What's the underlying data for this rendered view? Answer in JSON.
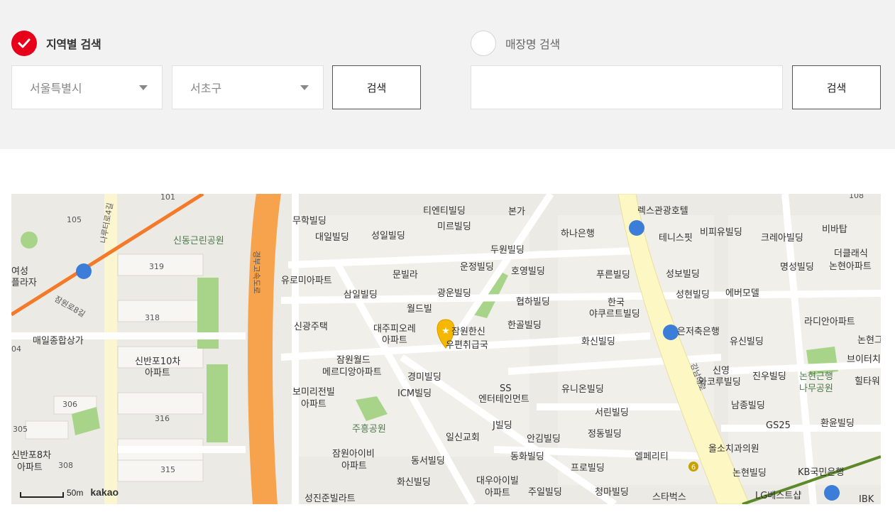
{
  "region_search": {
    "label": "지역별 검색",
    "checked": true,
    "city": "서울특별시",
    "district": "서초구",
    "button": "검색"
  },
  "store_search": {
    "label": "매장명 검색",
    "checked": false,
    "value": "",
    "button": "검색"
  },
  "map": {
    "scale": "50m",
    "provider": "kakao",
    "highway": "경부고속도로",
    "main_road": "강남대로",
    "side_road_1": "나루터로4길",
    "side_road_2": "잠원로8길",
    "labels": {
      "b101": "101",
      "b105": "105",
      "b319": "319",
      "b318": "318",
      "b306": "306",
      "b305": "305",
      "b316": "316",
      "b308": "308",
      "b315": "315",
      "b04": "04",
      "b108": "108",
      "yeoseong": "여성",
      "plaza": "플라자",
      "sindong_park": "신동근린공원",
      "maeil": "매일종합상가",
      "sinbanpo10": "신반포10차",
      "apt1": "아파트",
      "sinbanpo8": "신반포8차",
      "apt2": "아파트",
      "muhak": "무학빌딩",
      "daeil": "대일빌딩",
      "sungil": "성일빌딩",
      "tienti": "티엔티빌딩",
      "mirue": "미르빌딩",
      "bonga": "본가",
      "europe": "유로미아파트",
      "munvilla": "문빌라",
      "samil": "삼일빌딩",
      "gwangeun": "광운빌딩",
      "world": "월드빌",
      "shingwang": "신광주택",
      "daeju1": "대주피오레",
      "daeju2": "아파트",
      "jamwon_post1": "잠원한신",
      "jamwon_post2": "우편취급국",
      "jamwon_world1": "잠원월드",
      "jamwon_world2": "메르디앙아파트",
      "gyeongmi": "경미빌딩",
      "icm": "ICM빌딩",
      "bomi1": "보미리전빌",
      "bomi2": "아파트",
      "juheung": "주흥공원",
      "ss1": "SS",
      "ss2": "엔터테인먼트",
      "jbld": "J빌딩",
      "ilsin": "일신교회",
      "jamwon_ivy1": "잠원아이비",
      "jamwon_ivy2": "아파트",
      "dongseo": "동서빌딩",
      "hwasin2": "화신빌딩",
      "daewoo1": "대우아이빌",
      "daewoo2": "아파트",
      "jugim": "주일빌딩",
      "seongjin": "성진준빌라트",
      "duwon": "두원빌딩",
      "unjeong": "운정빌딩",
      "hoyoung": "호영빌딩",
      "hyupha": "협하빌딩",
      "hangol": "한골빌딩",
      "hwasin": "화신빌딩",
      "yuni": "유니온빌딩",
      "seorin": "서린빌딩",
      "jeongdong": "정동빌딩",
      "angim": "안김빌딩",
      "donghwa": "동화빌딩",
      "pro": "프로빌딩",
      "cheongma": "청마빌딩",
      "hana": "하나은행",
      "purun": "푸른빌딩",
      "yakult1": "한국",
      "yakult2": "야쿠르트빌딩",
      "lex": "렉스관광호텔",
      "tennis": "테니스핏",
      "bipi": "비피유빌딩",
      "korea": "크레아빌딩",
      "bibatap": "비바탑",
      "theclassic1": "더클래식",
      "theclassic2": "논현아파트",
      "seongbo": "성보빌딩",
      "seonghyun": "성현빌딩",
      "every": "에버모델",
      "myeongseong": "명성빌딩",
      "radian": "라디안아파트",
      "nonhyeon_r": "논현그",
      "brighter": "브이터치",
      "eunjeo": "은저축은행",
      "yusin": "유신빌딩",
      "sinyoung1": "신영",
      "sinyoung2": "와코루빌딩",
      "jinwoo": "진우빌딩",
      "nonhyeon_park1": "논현근행",
      "nonhyeon_park2": "나무공원",
      "hilltop": "힐타워이",
      "namjong": "남종빌딩",
      "gs25": "GS25",
      "hwanyoon": "환윤빌딩",
      "allso": "올소치과의원",
      "kb": "KB국민은행",
      "nonhyeon_bld": "논현빌딩",
      "lg": "LG베스트샵",
      "ibk": "IBK",
      "elpatio": "엘페리티",
      "starbucks": "스타벅스",
      "line6": "6"
    }
  },
  "colors": {
    "accent": "#e60019",
    "highway": "#f7a34d",
    "main_road": "#fdf7c3",
    "park": "#a8d48a",
    "marker": "#f5b800",
    "bus": "#3b7dd8"
  }
}
